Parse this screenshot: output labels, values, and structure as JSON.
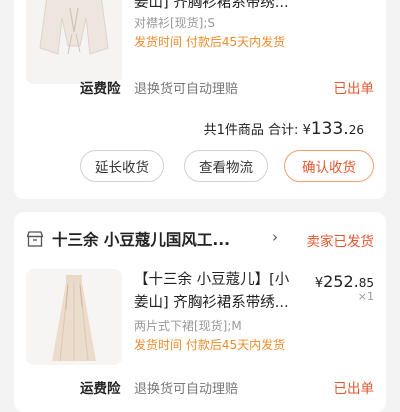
{
  "order1": {
    "title_line": "姜山] 齐胸衫裙系带绣...",
    "spec": "对襟衫[现货];S",
    "ship": "发货时间  付款后45天内发货",
    "insurance_label": "运费险",
    "insurance_desc": "退换货可自动理赔",
    "insurance_status": "已出单",
    "summary_prefix": "共1件商品 合计:",
    "currency": "¥",
    "total_int": "133.",
    "total_dec": "26",
    "buttons": [
      "延长收货",
      "查看物流",
      "确认收货"
    ]
  },
  "order2": {
    "shop_name": "十三余 小豆蔻儿国风工...",
    "shop_chevron": "›",
    "shop_status": "卖家已发货",
    "title_line1": "【十三余 小豆蔻儿】[小",
    "title_line2": "姜山] 齐胸衫裙系带绣...",
    "price_currency": "¥",
    "price_int": "252.",
    "price_dec": "85",
    "qty": "×1",
    "spec": "两片式下裙[现货];M",
    "ship": "发货时间  付款后45天内发货",
    "insurance_label": "运费险",
    "insurance_desc": "退换货可自动理赔",
    "insurance_status": "已出单"
  },
  "icons": {
    "shop": "shop-icon",
    "chevron": "chevron-right-icon"
  },
  "colors": {
    "accent": "#e4572e",
    "ship_time": "#ee8b2c",
    "background": "#f3f3f3"
  }
}
